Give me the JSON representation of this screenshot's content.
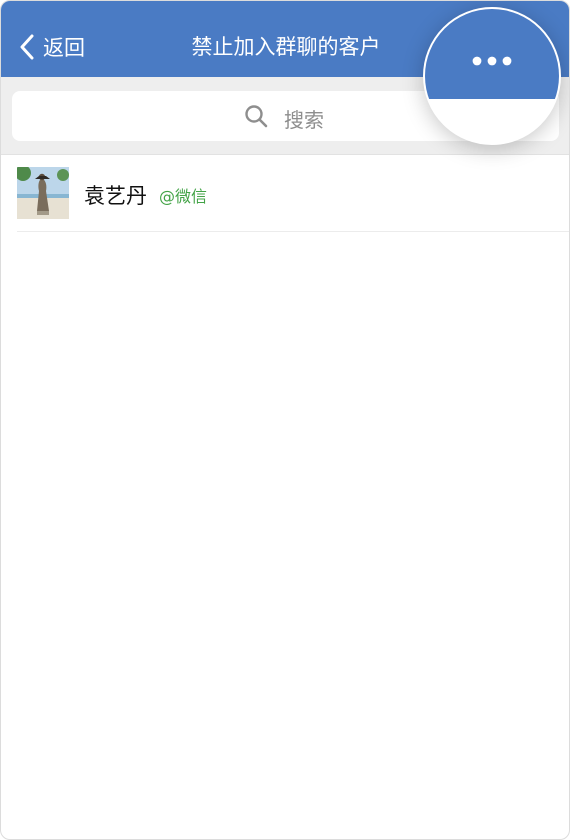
{
  "navbar": {
    "back_label": "返回",
    "title": "禁止加入群聊的客户",
    "more_icon": "more-horizontal-icon",
    "back_icon": "chevron-left-icon",
    "background_color": "#4a7bc4"
  },
  "search": {
    "placeholder": "搜索",
    "icon": "search-icon"
  },
  "contacts": [
    {
      "name": "袁艺丹",
      "tag": "@微信",
      "tag_color": "#43a347"
    }
  ]
}
